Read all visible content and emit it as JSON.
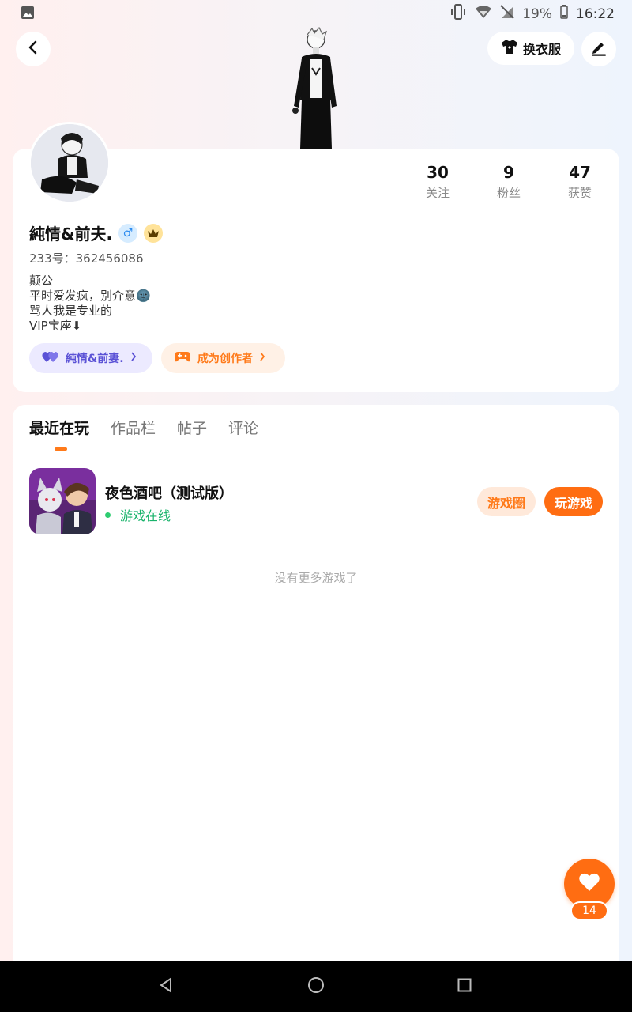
{
  "status_bar": {
    "battery": "19%",
    "time": "16:22"
  },
  "header": {
    "outfit_label": "换衣服"
  },
  "profile": {
    "name": "純情&前夫.",
    "gender_symbol": "♂",
    "uid": "233号：362456086",
    "bio": [
      "颠公",
      "平时爱发疯，别介意🌚",
      "骂人我是专业的",
      "VIP宝座⬇"
    ],
    "stats": [
      {
        "count": "30",
        "label": "关注"
      },
      {
        "count": "9",
        "label": "粉丝"
      },
      {
        "count": "47",
        "label": "获赞"
      }
    ],
    "cp_pill": "純情&前妻.",
    "creator_pill": "成为创作者"
  },
  "tabs": [
    "最近在玩",
    "作品栏",
    "帖子",
    "评论"
  ],
  "active_tab": "最近在玩",
  "games": [
    {
      "title": "夜色酒吧（测试版）",
      "status": "游戏在线",
      "circle_label": "游戏圈",
      "play_label": "玩游戏"
    }
  ],
  "no_more_text": "没有更多游戏了",
  "like_count": "14",
  "colors": {
    "accent": "#ff6d12",
    "online": "#19b36b",
    "cp_purple": "#5b52d6"
  },
  "icons": {
    "back": "chevron-left-icon",
    "outfit": "shirt-icon",
    "edit": "pen-icon",
    "like": "heart-icon"
  }
}
